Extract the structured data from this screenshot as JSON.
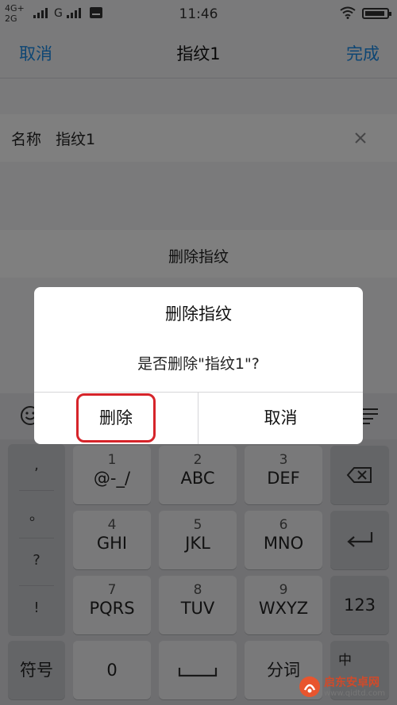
{
  "status_bar": {
    "network_1": "4G+",
    "network_2": "2G",
    "network_3": "G",
    "time": "11:46"
  },
  "nav": {
    "cancel": "取消",
    "title": "指纹1",
    "done": "完成"
  },
  "name_row": {
    "label": "名称",
    "value": "指纹1"
  },
  "delete_row": {
    "label": "删除指纹"
  },
  "dialog": {
    "title": "删除指纹",
    "message": "是否删除\"指纹1\"?",
    "delete_button": "删除",
    "cancel_button": "取消",
    "highlight_color": "#d6242a"
  },
  "keyboard": {
    "side_keys": [
      ",",
      "。",
      "?",
      "!"
    ],
    "keys": [
      {
        "num": "1",
        "letters": "@-_/"
      },
      {
        "num": "2",
        "letters": "ABC"
      },
      {
        "num": "3",
        "letters": "DEF"
      },
      {
        "num": "4",
        "letters": "GHI"
      },
      {
        "num": "5",
        "letters": "JKL"
      },
      {
        "num": "6",
        "letters": "MNO"
      },
      {
        "num": "7",
        "letters": "PQRS"
      },
      {
        "num": "8",
        "letters": "TUV"
      },
      {
        "num": "9",
        "letters": "WXYZ"
      }
    ],
    "symbols": "符号",
    "zero": "0",
    "num_switch": "123",
    "word_key": "分词",
    "lang_key": "中"
  },
  "watermark": {
    "name": "启东安卓网",
    "url": "www.qidtd.com"
  },
  "colors": {
    "accent": "#1a8ce8"
  }
}
